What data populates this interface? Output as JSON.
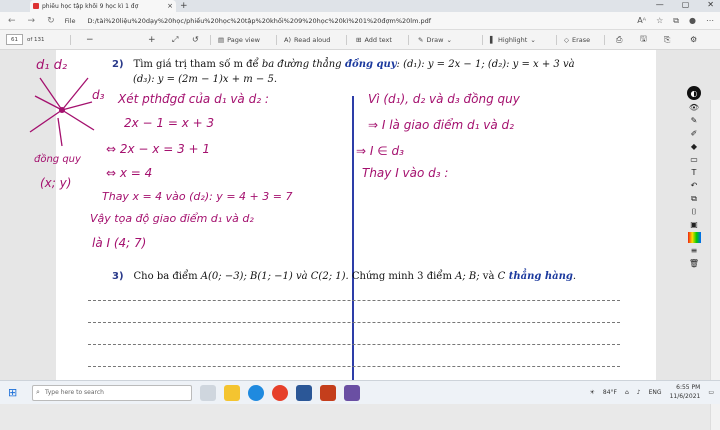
{
  "browser": {
    "tab_title": "phiếu học tập khối 9 học kì 1 đợ",
    "new_tab": "+",
    "minimize": "—",
    "maximize": "▢",
    "close": "✕"
  },
  "address": {
    "file_label": "File",
    "url": "D:/tài%20liệu%20dạy%20học/phiếu%20học%20tập%20khối%209%20học%20kì%201%20đợm%20lm.pdf"
  },
  "pdf_toolbar": {
    "page_current": "61",
    "page_total": "of 131",
    "zoom_out": "−",
    "zoom_in": "+",
    "page_view": "Page view",
    "read_aloud": "Read aloud",
    "add_text": "Add text",
    "draw": "Draw",
    "highlight": "Highlight",
    "erase": "Erase"
  },
  "q2": {
    "num": "2)",
    "pre": "Tìm giá trị tham số m để ",
    "italic": "ba đường thẳng",
    "bold": " đồng quy",
    "line1_rest": ": (d₁): y = 2x − 1; (d₂): y = x + 3 và",
    "line2": "(d₃): y = (2m − 1)x + m − 5."
  },
  "q3": {
    "num": "3)",
    "pre": "Cho ba điểm ",
    "math": "A(0; −3); B(1; −1) và C(2; 1).",
    "mid": " Chứng minh 3 điểm ",
    "pts": "A; B;",
    "va": " và ",
    "c": "C",
    "bold": " thẳng hàng",
    "end": "."
  },
  "handwriting": {
    "left": [
      "Xét pthđgđ của d₁ và d₂ :",
      "2x − 1 = x + 3",
      "⇔ 2x − x = 3 + 1",
      "⇔  x = 4",
      "Thay x = 4 vào (d₂): y = 4 + 3 = 7",
      "Vậy tọa độ giao điểm d₁ và d₂",
      "là I (4; 7)"
    ],
    "right": [
      "Vì (d₁), d₂ và d₃ đồng quy",
      "⇒ I là giao điểm d₁ và d₂",
      "⇒ I ∈ d₃",
      "Thay I vào d₃ :"
    ],
    "margin": [
      "d₁ d₂",
      "d₃",
      "đồng quy",
      "(x; y)"
    ]
  },
  "taskbar": {
    "search": "Type here to search",
    "temp": "84°F",
    "lang": "ENG",
    "time": "6:55 PM",
    "date": "11/6/2021"
  }
}
